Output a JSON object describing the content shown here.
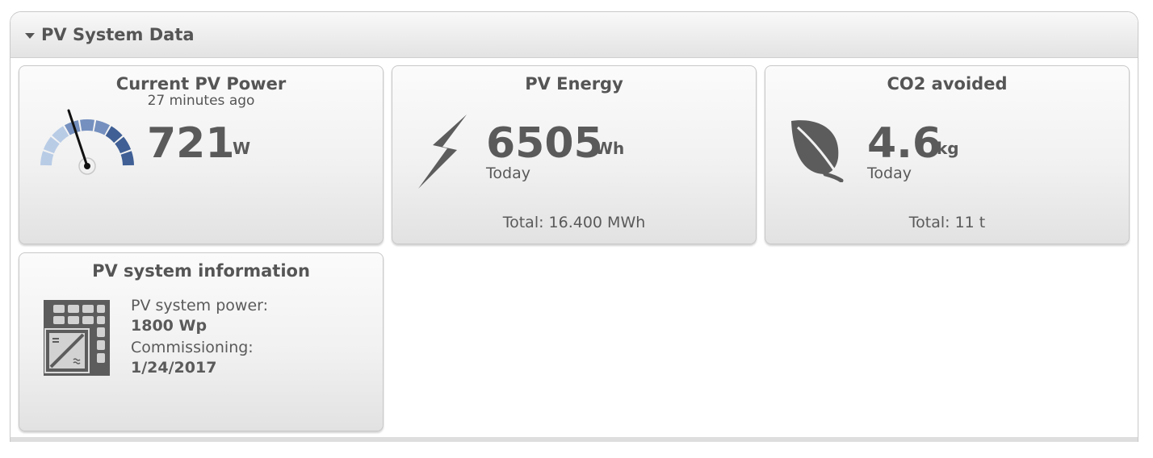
{
  "panel": {
    "title": "PV System Data"
  },
  "current_power": {
    "title": "Current PV Power",
    "subtitle": "27 minutes ago",
    "value": "721",
    "unit": "W",
    "icon": "gauge-icon"
  },
  "energy": {
    "title": "PV Energy",
    "value": "6505",
    "unit": "Wh",
    "period": "Today",
    "total": "Total: 16.400 MWh",
    "icon": "lightning-bolt-icon"
  },
  "co2": {
    "title": "CO2 avoided",
    "value": "4.6",
    "unit": "kg",
    "period": "Today",
    "total": "Total: 11 t",
    "icon": "leaf-icon"
  },
  "system_info": {
    "title": "PV system information",
    "power_label": "PV system power:",
    "power_value": "1800 Wp",
    "commissioning_label": "Commissioning:",
    "commissioning_value": "1/24/2017",
    "icon": "solar-inverter-icon"
  },
  "colors": {
    "gauge_dark": "#3f5f95",
    "gauge_mid": "#7590bf",
    "gauge_light": "#b9cce6",
    "icon_gray": "#5c5c5c"
  }
}
